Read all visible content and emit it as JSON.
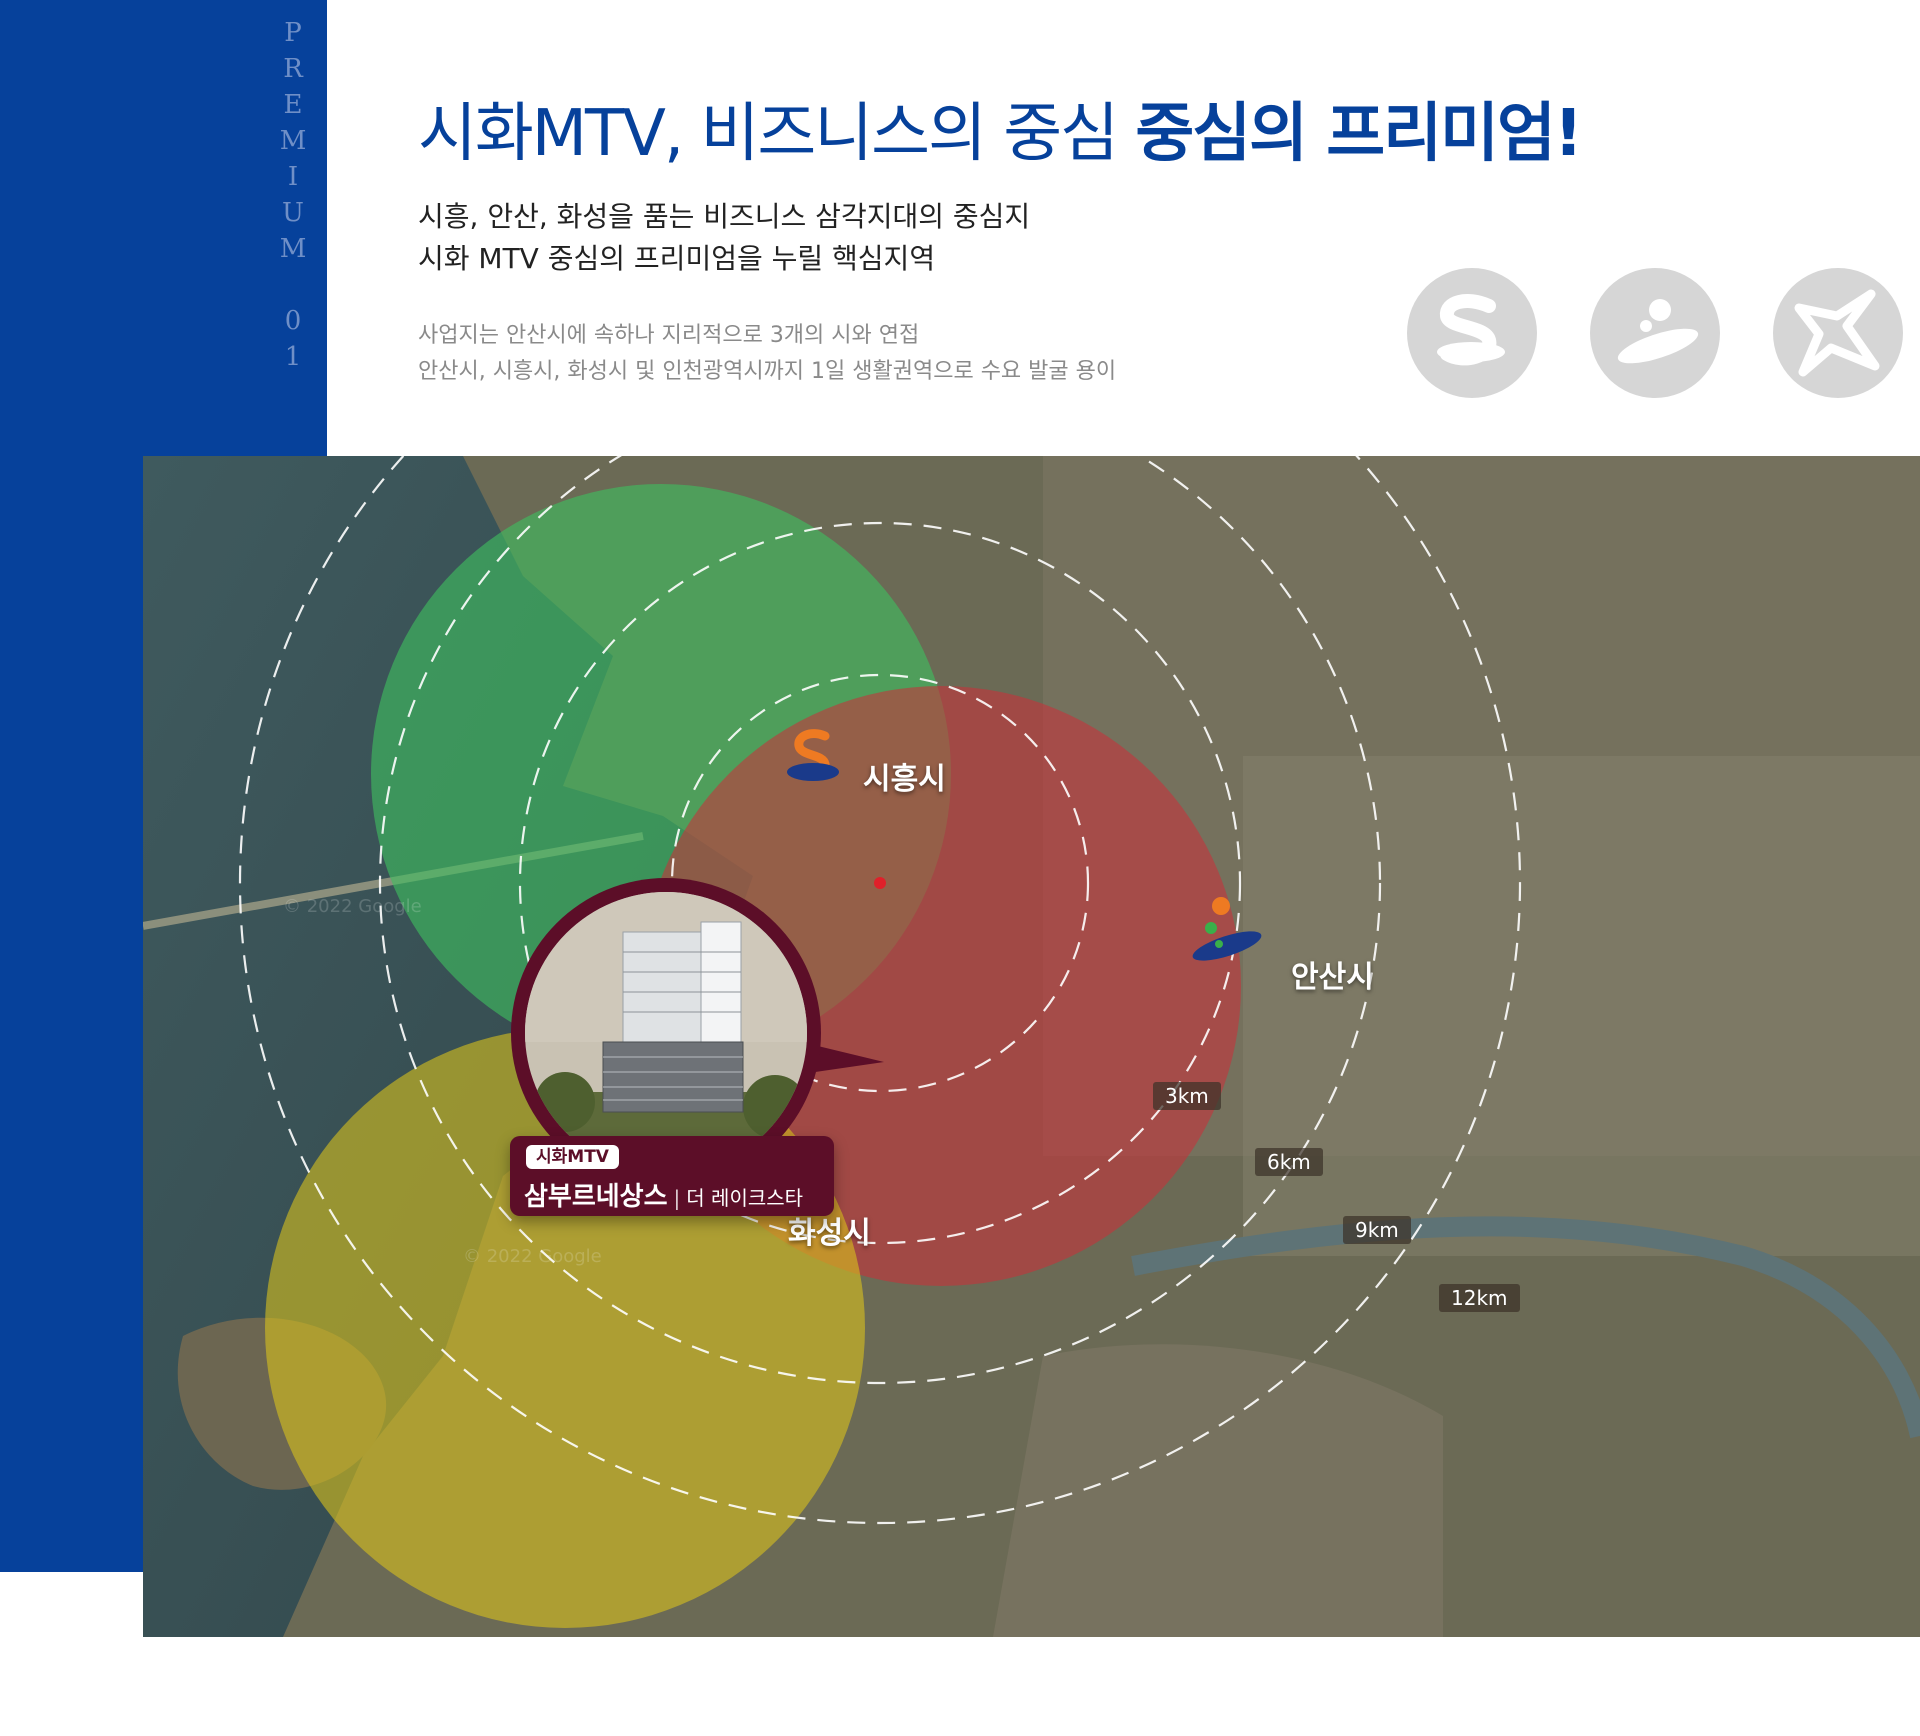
{
  "sidebar": {
    "vertical_tag": "PREMIUM 01"
  },
  "header": {
    "title_light": "시화MTV, 비즈니스의 중심",
    "title_bold": "중심의 프리미엄!",
    "subtitle_line1": "시흥, 안산, 화성을 품는 비즈니스 삼각지대의 중심지",
    "subtitle_line2": "시화 MTV 중심의 프리미엄을 누릴 핵심지역",
    "desc_line1": "사업지는 안산시에 속하나 지리적으로 3개의 시와 연접",
    "desc_line2": "안산시, 시흥시, 화성시 및 인천광역시까지 1일 생활권역으로 수요 발굴 용이"
  },
  "city_icons": [
    {
      "name": "siheung-logo-icon"
    },
    {
      "name": "ansan-logo-icon"
    },
    {
      "name": "hwaseong-logo-icon"
    }
  ],
  "map": {
    "cities": [
      {
        "name": "시흥시",
        "color": "#3fbf60"
      },
      {
        "name": "안산시",
        "color": "#c8323a"
      },
      {
        "name": "화성시",
        "color": "#d9c21c"
      }
    ],
    "distances": [
      "3km",
      "6km",
      "9km",
      "12km"
    ],
    "watermarks": [
      "© 2022 Google",
      "© 2022 Google"
    ],
    "site": {
      "badge": "시화MTV",
      "name": "삼부르네상스",
      "sub": "더 레이크스타"
    }
  },
  "colors": {
    "brand": "#06419b",
    "site": "#5c0e28"
  }
}
